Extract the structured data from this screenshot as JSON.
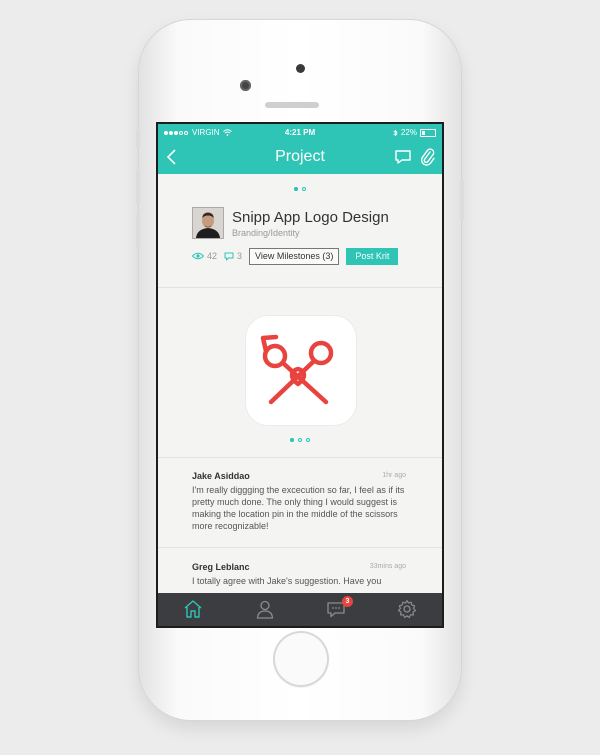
{
  "colors": {
    "accent": "#2ec4b6",
    "tabbar": "#3b3d40",
    "badge": "#e8433f",
    "logo": "#e8433f"
  },
  "statusbar": {
    "carrier": "VIRGIN",
    "time": "4:21 PM",
    "battery": "22%"
  },
  "navbar": {
    "title": "Project",
    "back_icon": "chevron-left-icon",
    "chat_icon": "chat-icon",
    "attach_icon": "paperclip-icon"
  },
  "header_pager": {
    "count": 2,
    "active": 0
  },
  "project": {
    "title": "Snipp App Logo Design",
    "category": "Branding/Identity",
    "views": "42",
    "comments": "3",
    "milestones_label": "View Milestones (3)",
    "post_label": "Post Krit"
  },
  "image_pager": {
    "count": 3,
    "active": 0
  },
  "comments": [
    {
      "author": "Jake Asiddao",
      "time": "1hr ago",
      "text": "I'm really diggging the excecution so far, I feel as if its pretty much done. The only thing I would suggest is making the location pin in the middle of the scissors more recognizable!"
    },
    {
      "author": "Greg Leblanc",
      "time": "33mins ago",
      "text": "I totally agree with Jake's suggestion. Have you"
    }
  ],
  "tabbar": {
    "items": [
      "home-icon",
      "profile-icon",
      "messages-icon",
      "settings-icon"
    ],
    "active": 0,
    "messages_badge": "3"
  }
}
